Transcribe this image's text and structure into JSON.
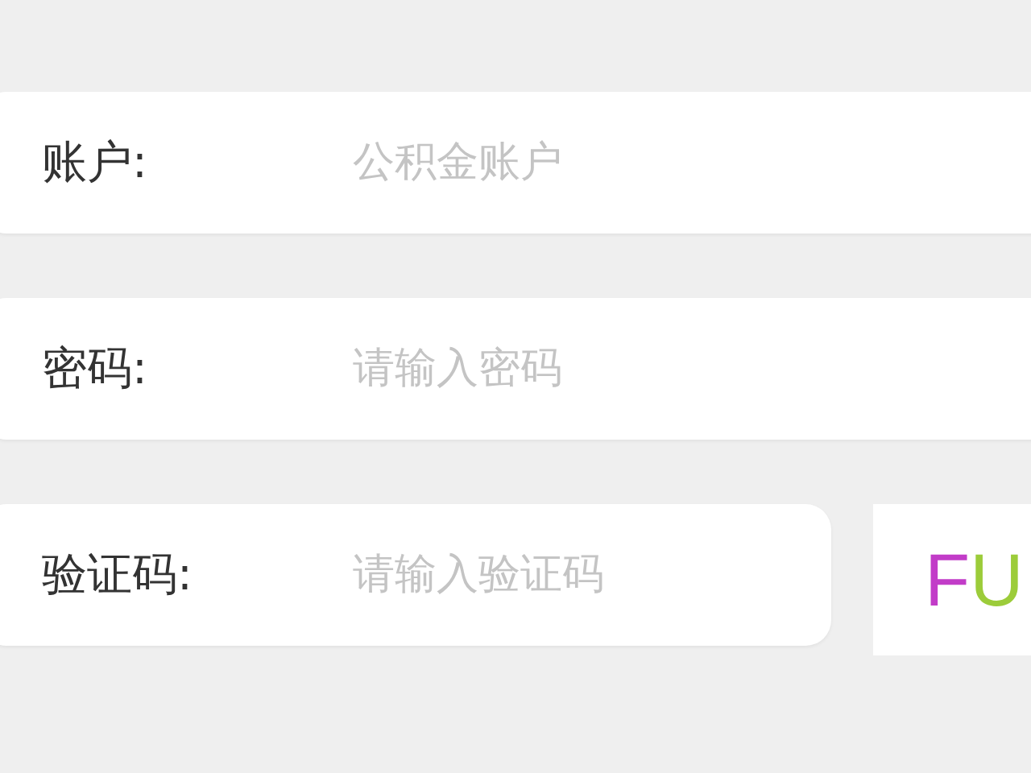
{
  "fields": [
    {
      "label": "账户:",
      "placeholder": "公积金账户",
      "kind": "full"
    },
    {
      "label": "密码:",
      "placeholder": "请输入密码",
      "kind": "full"
    },
    {
      "label": "验证码:",
      "placeholder": "请输入验证码",
      "kind": "captcha"
    }
  ],
  "captcha": {
    "chars": [
      {
        "text": "F",
        "color": "#c23cc8"
      },
      {
        "text": "U",
        "color": "#9ccc3a"
      }
    ]
  }
}
